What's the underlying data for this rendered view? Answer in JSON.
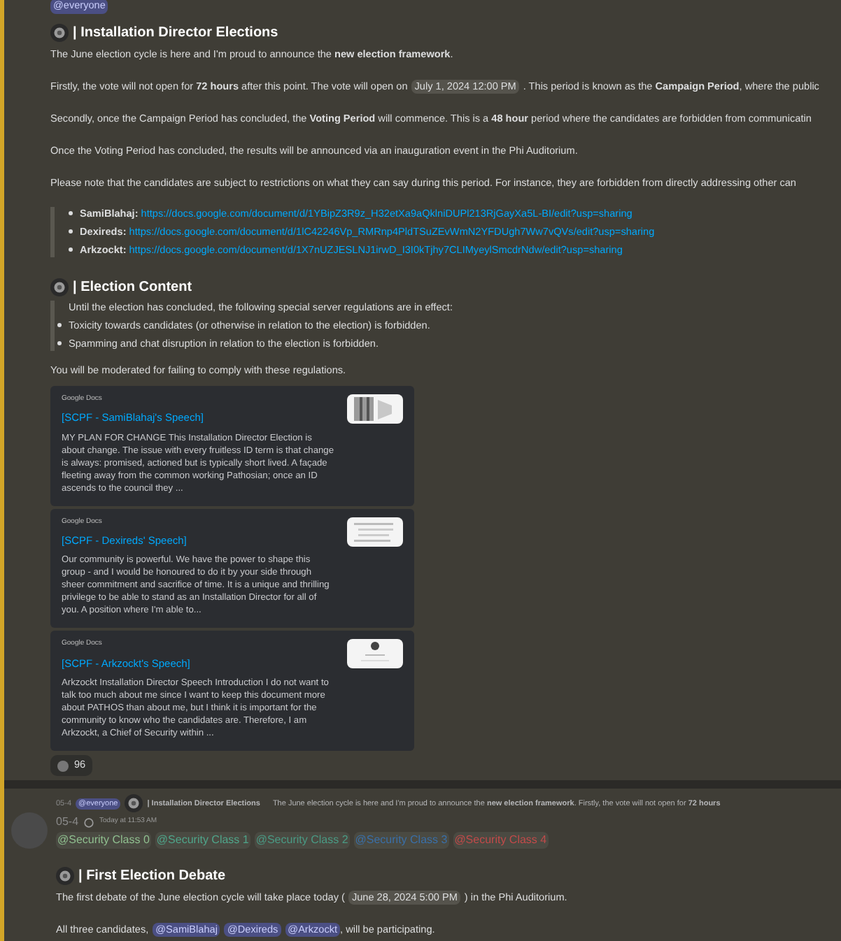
{
  "messages": [
    {
      "mention": "@everyone",
      "blocks": [
        {
          "kind": "heading",
          "text": "| Installation Director Elections"
        },
        {
          "kind": "paragraph",
          "segments": [
            {
              "kind": "text",
              "text": "The June election cycle is here and I'm proud to announce the **new election framework**."
            }
          ]
        },
        {
          "kind": "paragraph",
          "segments": [
            {
              "kind": "text",
              "text": "Firstly, the vote will not open for **72 hours** after this point. The vote will open on"
            },
            {
              "kind": "timestamp",
              "text": "July 1, 2024 12:00 PM"
            },
            {
              "kind": "text",
              "text": ". This period is known as the **Campaign Period**, where the public"
            }
          ]
        },
        {
          "kind": "paragraph",
          "segments": [
            {
              "kind": "text",
              "text": "Secondly, once the Campaign Period has concluded, the **Voting Period** will commence. This is a **48 hour** period where the candidates are forbidden from communicatin"
            }
          ]
        },
        {
          "kind": "paragraph",
          "segments": [
            {
              "kind": "text",
              "text": "Once the Voting Period has concluded, the results will be announced via an inauguration event in the Phi Auditorium."
            }
          ]
        },
        {
          "kind": "paragraph",
          "segments": [
            {
              "kind": "text",
              "text": "Please note that the candidates are subject to restrictions on what they can say during this period. For instance, they are forbidden from directly addressing other can"
            }
          ]
        },
        {
          "kind": "quote",
          "items": [
            {
              "kind": "link_bullet",
              "name": "SamiBlahaj:",
              "url": "https://docs.google.com/document/d/1YBipZ3R9z_H32etXa9aQklniDUPl213RjGayXa5L-BI/edit?usp=sharing"
            },
            {
              "kind": "link_bullet",
              "name": "Dexireds:",
              "url": "https://docs.google.com/document/d/1lC42246Vp_RMRnp4PldTSuZEvWmN2YFDUgh7Ww7vQVs/edit?usp=sharing"
            },
            {
              "kind": "link_bullet",
              "name": "Arkzockt:",
              "url": "https://docs.google.com/document/d/1X7nUZJESLNJ1irwD_I3I0kTjhy7CLIMyeylSmcdrNdw/edit?usp=sharing"
            }
          ]
        },
        {
          "kind": "heading",
          "text": "| Election Content"
        },
        {
          "kind": "quote",
          "items": [
            {
              "kind": "line",
              "text": "Until the election has concluded, the following special server regulations are in effect:"
            },
            {
              "kind": "bullet",
              "text": "Toxicity towards candidates (or otherwise in relation to the election) is forbidden."
            },
            {
              "kind": "bullet",
              "text": "Spamming and chat disruption in relation to the election is forbidden."
            }
          ]
        },
        {
          "kind": "paragraph",
          "segments": [
            {
              "kind": "text",
              "text": "You will be moderated for failing to comply with these regulations."
            }
          ]
        }
      ],
      "embeds": [
        {
          "provider": "Google Docs",
          "title": "[SCPF - SamiBlahaj's Speech]",
          "description": "MY PLAN FOR CHANGE This Installation Director Election is about change. The issue with every fruitless ID term is that change is always: promised, actioned but is typically short lived. A façade fleeting away from the common working Pathosian; once an ID ascends to the council they ..."
        },
        {
          "provider": "Google Docs",
          "title": "[SCPF - Dexireds' Speech]",
          "description": "Our community is powerful. We have the power to shape this group - and I would be honoured to do it by your side through sheer commitment and sacrifice of time. It is a unique and thrilling privilege to be able to stand as an Installation Director for all of you. A position where I'm able to..."
        },
        {
          "provider": "Google Docs",
          "title": "[SCPF - Arkzockt's Speech]",
          "description": "Arkzockt Installation Director Speech Introduction I do not want to talk too much about me since I want to keep this document more about PATHOS than about me, but I think it is important for the community to know who the candidates are. Therefore, I am Arkzockt, a Chief of Security within ..."
        }
      ],
      "reaction": {
        "count": "96"
      }
    },
    {
      "reply": {
        "author": "05-4",
        "mention": "@everyone",
        "title": "| Installation Director Elections",
        "preview": "The June election cycle is here and I'm proud to announce the **new election framework**.  Firstly, the vote will not open for **72 hours**"
      },
      "author": "05-4",
      "timestamp": "Today at 11:53 AM",
      "roles": [
        {
          "text": "@Security Class 0",
          "color": "#8fbf8f"
        },
        {
          "text": "@Security Class 1",
          "color": "#4fa58a"
        },
        {
          "text": "@Security Class 2",
          "color": "#4a9a84"
        },
        {
          "text": "@Security Class 3",
          "color": "#3a6fa8"
        },
        {
          "text": "@Security Class 4",
          "color": "#c24a4a"
        }
      ],
      "blocks": [
        {
          "kind": "heading",
          "text": "| First Election Debate"
        },
        {
          "kind": "paragraph",
          "segments": [
            {
              "kind": "text",
              "text": "The first debate of the June election cycle will take place today ("
            },
            {
              "kind": "timestamp",
              "text": "June 28, 2024 5:00 PM"
            },
            {
              "kind": "text",
              "text": ") in the Phi Auditorium."
            }
          ]
        },
        {
          "kind": "paragraph",
          "segments": [
            {
              "kind": "text",
              "text": "All three candidates,"
            },
            {
              "kind": "mention",
              "text": "@SamiBlahaj"
            },
            {
              "kind": "mention",
              "text": "@Dexireds"
            },
            {
              "kind": "mention",
              "text": "@Arkzockt"
            },
            {
              "kind": "text",
              "text": ", will be participating."
            }
          ]
        }
      ]
    }
  ]
}
